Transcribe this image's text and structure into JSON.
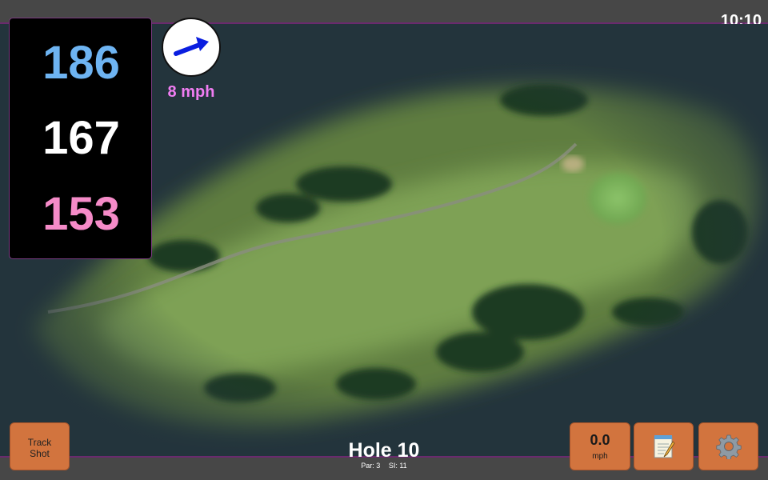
{
  "status": {
    "time": "10:10"
  },
  "distances": {
    "back": "186",
    "middle": "167",
    "front": "153"
  },
  "wind": {
    "speed": "8 mph",
    "direction_icon": "arrow-right-icon"
  },
  "hole": {
    "title": "Hole 10",
    "par": "Par: 3",
    "stroke_index": "SI: 11"
  },
  "buttons": {
    "track_shot_line1": "Track",
    "track_shot_line2": "Shot",
    "speed_value": "0.0",
    "speed_unit": "mph",
    "notes_icon": "notepad-icon",
    "settings_icon": "gear-icon"
  },
  "colors": {
    "back_distance": "#6eb4f2",
    "middle_distance": "#ffffff",
    "front_distance": "#f58bc8",
    "wind_text": "#f07df2",
    "button": "#d2743e",
    "accent_border": "#6a2a6e"
  }
}
